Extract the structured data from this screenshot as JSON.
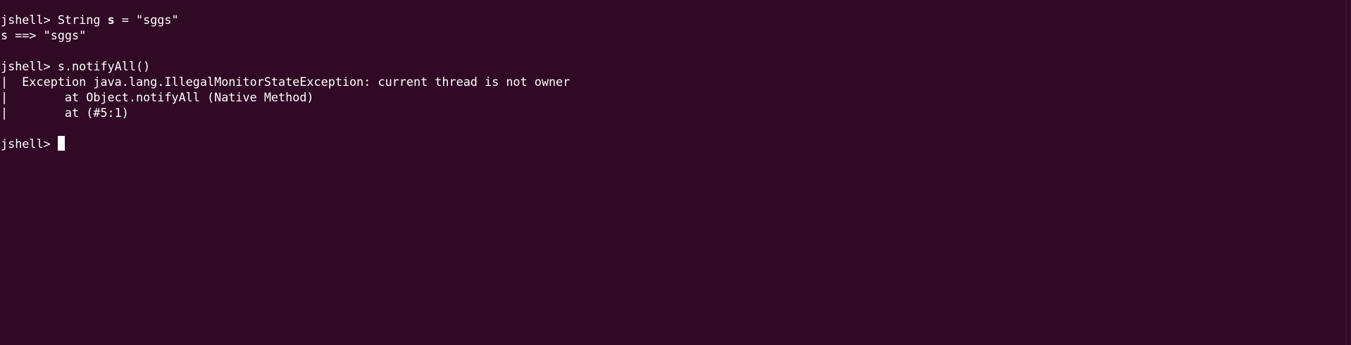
{
  "terminal": {
    "prompt": "jshell> ",
    "line1": {
      "before": "String ",
      "bold": "s",
      "after": " = \"sggs\""
    },
    "line2": "s ==> \"sggs\"",
    "line3": "",
    "line4": "s.notifyAll()",
    "line5": "|  Exception java.lang.IllegalMonitorStateException: current thread is not owner",
    "line6": "|        at Object.notifyAll (Native Method)",
    "line7": "|        at (#5:1)",
    "line8": ""
  },
  "colors": {
    "background": "#300a24",
    "foreground": "#ffffff"
  }
}
